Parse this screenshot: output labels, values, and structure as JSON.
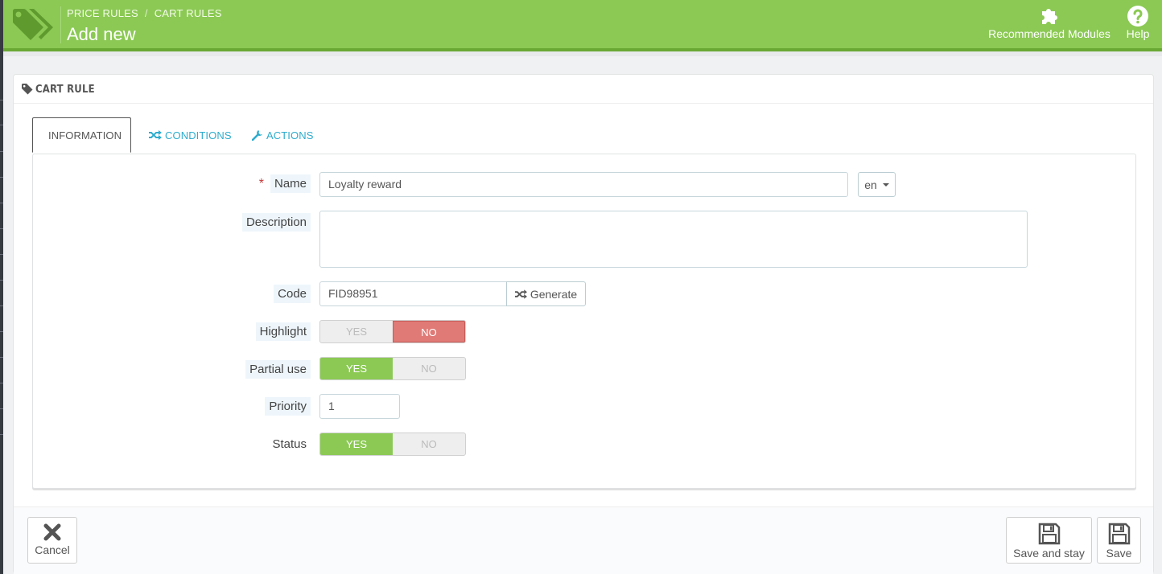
{
  "header": {
    "breadcrumb": [
      "PRICE RULES",
      "CART RULES"
    ],
    "breadcrumb_separator": "/",
    "title": "Add new",
    "toolbar": {
      "recommended_modules": "Recommended Modules",
      "help": "Help"
    }
  },
  "panel": {
    "heading": "CART RULE",
    "tabs": [
      {
        "label": "INFORMATION",
        "icon": "info-icon",
        "active": true
      },
      {
        "label": "CONDITIONS",
        "icon": "random-icon",
        "active": false
      },
      {
        "label": "ACTIONS",
        "icon": "wrench-icon",
        "active": false
      }
    ]
  },
  "form": {
    "required_marker": "*",
    "name": {
      "label": "Name",
      "value": "Loyalty reward",
      "language": "en"
    },
    "description": {
      "label": "Description",
      "value": ""
    },
    "code": {
      "label": "Code",
      "value": "FID98951",
      "generate_label": "Generate"
    },
    "highlight": {
      "label": "Highlight",
      "yes": "YES",
      "no": "NO",
      "selected": "NO"
    },
    "partial_use": {
      "label": "Partial use",
      "yes": "YES",
      "no": "NO",
      "selected": "YES"
    },
    "priority": {
      "label": "Priority",
      "value": "1"
    },
    "status": {
      "label": "Status",
      "yes": "YES",
      "no": "NO",
      "selected": "YES"
    }
  },
  "footer": {
    "cancel": "Cancel",
    "save_and_stay": "Save and stay",
    "save": "Save"
  },
  "colors": {
    "header_green": "#8bc954",
    "active_green": "#8bc954",
    "no_red": "#e07a76",
    "link_blue": "#2eacce"
  }
}
